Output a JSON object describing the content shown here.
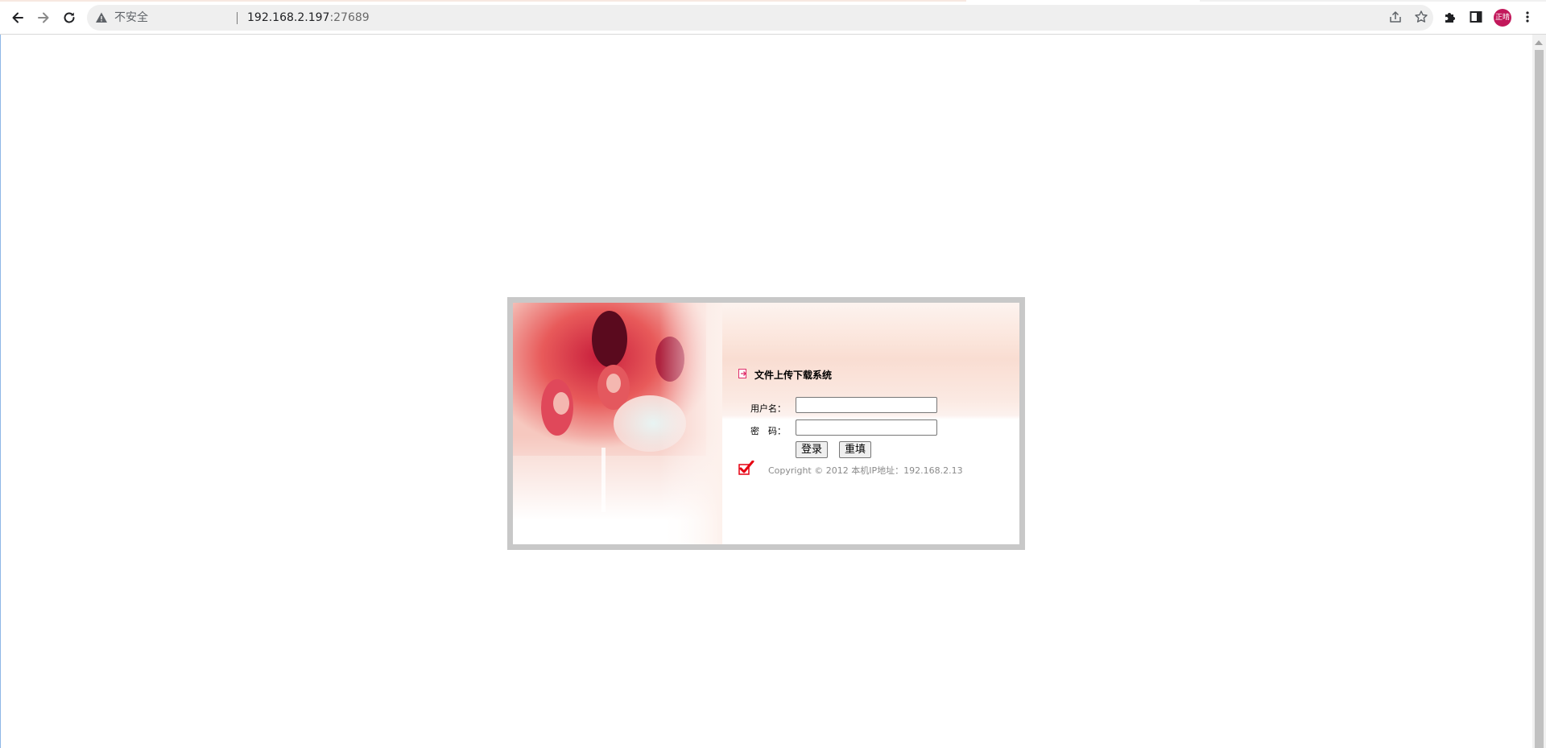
{
  "browser": {
    "security_label": "不安全",
    "url_host": "192.168.2.197",
    "url_port": ":27689",
    "profile_initials": "正晴"
  },
  "login": {
    "system_title": "文件上传下载系统",
    "username_label": "用户名：",
    "password_label": "密　码：",
    "username_value": "",
    "password_value": "",
    "login_button": "登录",
    "reset_button": "重填",
    "copyright": "Copyright © 2012 本机IP地址：192.168.2.13"
  },
  "colors": {
    "accent_pink": "#e0306c",
    "check_red": "#e60012",
    "frame_gray": "#c8c8c8",
    "avatar_bg": "#c2185b"
  }
}
